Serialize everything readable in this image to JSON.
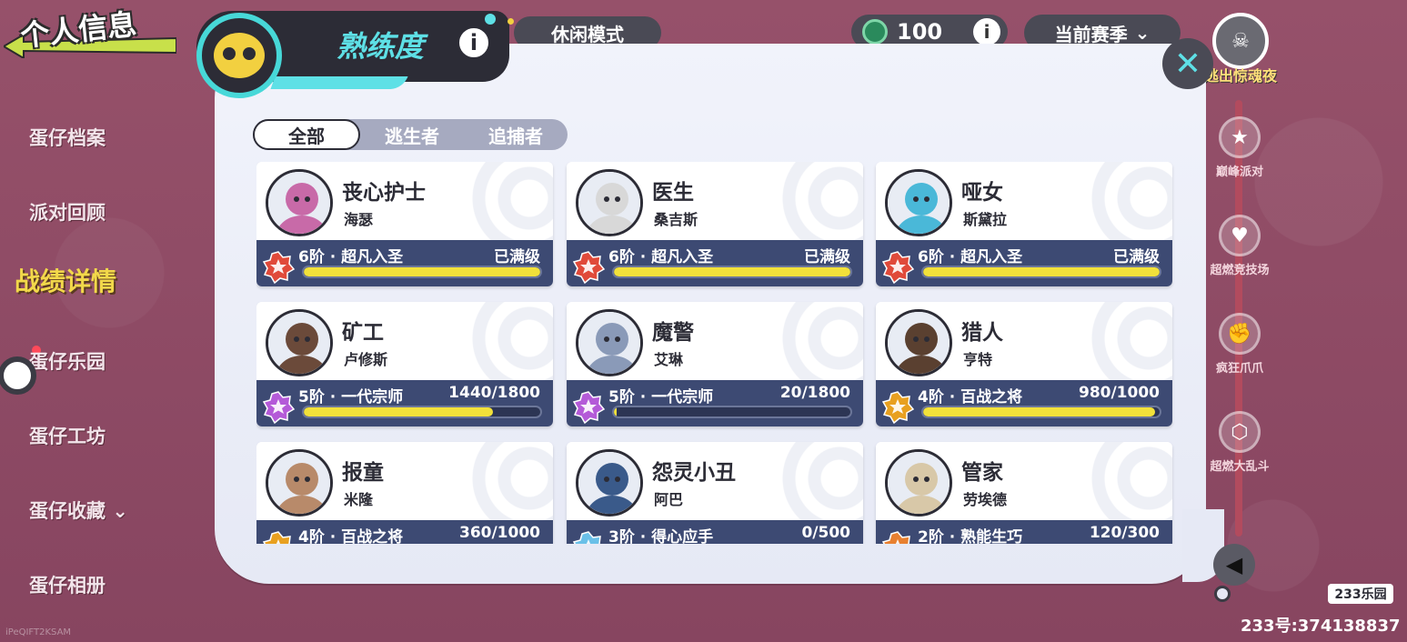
{
  "header": {
    "page_title": "个人信息",
    "mode": "休闲模式",
    "currency_amount": "100",
    "season": "当前赛季"
  },
  "sidebar": {
    "items": [
      {
        "label": "蛋仔档案"
      },
      {
        "label": "派对回顾"
      },
      {
        "label": "战绩详情"
      },
      {
        "label": "蛋仔乐园"
      },
      {
        "label": "蛋仔工坊"
      },
      {
        "label": "蛋仔收藏"
      },
      {
        "label": "蛋仔相册"
      }
    ],
    "bottom_text": "iPeQIFT2KSAM"
  },
  "events": {
    "top_label": "逃出惊魂夜",
    "items": [
      {
        "label": "巅峰派对",
        "icon": "party-icon"
      },
      {
        "label": "超燃竞技场",
        "icon": "arena-icon"
      },
      {
        "label": "疯狂爪爪",
        "icon": "claw-icon"
      },
      {
        "label": "超燃大乱斗",
        "icon": "brawl-icon"
      }
    ]
  },
  "panel": {
    "title": "熟练度",
    "tabs": [
      "全部",
      "逃生者",
      "追捕者"
    ],
    "active_tab": 0
  },
  "cards": [
    {
      "name": "丧心护士",
      "sub": "海瑟",
      "rank": "6阶 · 超凡入圣",
      "progress_text": "已满级",
      "fill": 1.0,
      "badge": "red",
      "avatar_color": "#c86aa8"
    },
    {
      "name": "医生",
      "sub": "桑吉斯",
      "rank": "6阶 · 超凡入圣",
      "progress_text": "已满级",
      "fill": 1.0,
      "badge": "red",
      "avatar_color": "#d8d8d8"
    },
    {
      "name": "哑女",
      "sub": "斯黛拉",
      "rank": "6阶 · 超凡入圣",
      "progress_text": "已满级",
      "fill": 1.0,
      "badge": "red",
      "avatar_color": "#4ab8d8"
    },
    {
      "name": "矿工",
      "sub": "卢修斯",
      "rank": "5阶 · 一代宗师",
      "progress_text": "1440/1800",
      "fill": 0.8,
      "badge": "purple",
      "avatar_color": "#6b4a3a"
    },
    {
      "name": "魔警",
      "sub": "艾琳",
      "rank": "5阶 · 一代宗师",
      "progress_text": "20/1800",
      "fill": 0.011,
      "badge": "purple",
      "avatar_color": "#8a9ab8"
    },
    {
      "name": "猎人",
      "sub": "亨特",
      "rank": "4阶 · 百战之将",
      "progress_text": "980/1000",
      "fill": 0.98,
      "badge": "gold",
      "avatar_color": "#5a4030"
    },
    {
      "name": "报童",
      "sub": "米隆",
      "rank": "4阶 · 百战之将",
      "progress_text": "360/1000",
      "fill": 0.36,
      "badge": "gold",
      "avatar_color": "#b88a6a"
    },
    {
      "name": "怨灵小丑",
      "sub": "阿巴",
      "rank": "3阶 · 得心应手",
      "progress_text": "0/500",
      "fill": 0.0,
      "badge": "blue",
      "avatar_color": "#3a5a8a"
    },
    {
      "name": "管家",
      "sub": "劳埃德",
      "rank": "2阶 · 熟能生巧",
      "progress_text": "120/300",
      "fill": 0.4,
      "badge": "orange",
      "avatar_color": "#d8c8a8"
    }
  ],
  "colors": {
    "badge_red": "#e04a3a",
    "badge_purple": "#b45ad8",
    "badge_gold": "#e8a020",
    "badge_blue": "#6ac0e8",
    "badge_orange": "#e88030",
    "accent_cyan": "#5ee0e6",
    "bar_fill": "#f2e13a"
  },
  "watermark": {
    "badge": "233乐园",
    "id": "233号:374138837"
  }
}
